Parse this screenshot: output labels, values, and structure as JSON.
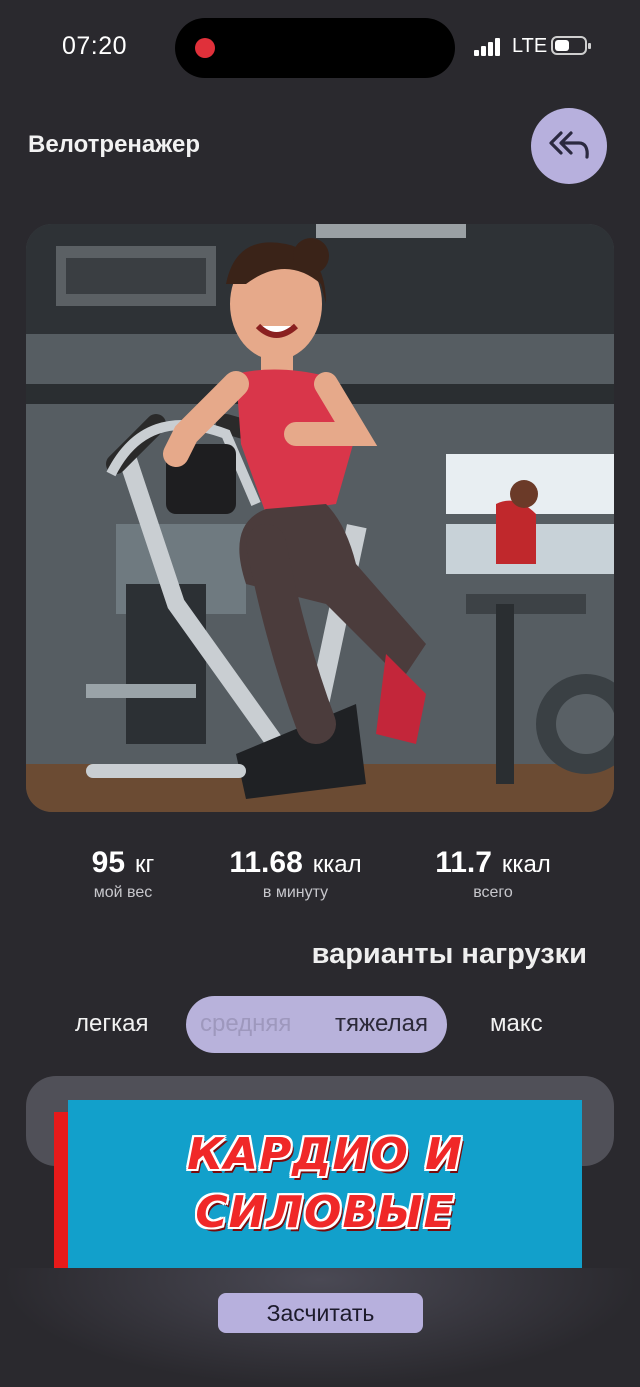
{
  "status_bar": {
    "time": "07:20",
    "network": "LTE",
    "icons": [
      "recording-dot-icon",
      "signal-icon",
      "battery-icon"
    ]
  },
  "header": {
    "title": "Велотренажер",
    "back_icon": "double-back-arrow-icon"
  },
  "hero_image": {
    "description_icon": "exercise-bike-illustration"
  },
  "stats": [
    {
      "value": "95",
      "unit": "кг",
      "label": "мой вес"
    },
    {
      "value": "11.68",
      "unit": "ккал",
      "label": "в минуту"
    },
    {
      "value": "11.7",
      "unit": "ккал",
      "label": "всего"
    }
  ],
  "load": {
    "heading": "варианты нагрузки",
    "options": [
      "легкая",
      "средняя",
      "тяжелая",
      "макс"
    ],
    "selected": "тяжелая"
  },
  "banner": {
    "line1": "КАРДИО И",
    "line2": "СИЛОВЫЕ",
    "colors": {
      "background": "#12a0cb",
      "text": "#f02828",
      "shadow": "#e71a1a"
    }
  },
  "actions": {
    "count_label": "Засчитать"
  },
  "colors": {
    "background": "#2a292e",
    "accent": "#b7b0dd"
  }
}
